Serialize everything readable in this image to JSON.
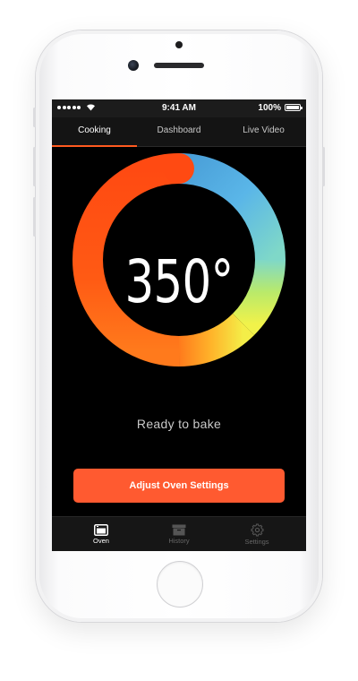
{
  "status_bar": {
    "time": "9:41 AM",
    "battery": "100%"
  },
  "tabs": [
    {
      "label": "Cooking",
      "active": true
    },
    {
      "label": "Dashboard",
      "active": false
    },
    {
      "label": "Live Video",
      "active": false
    }
  ],
  "oven": {
    "temperature": "350°",
    "status": "Ready to bake",
    "action_label": "Adjust Oven Settings",
    "gradient_colors": [
      "#ff4d12",
      "#ff8a1a",
      "#ffd43a",
      "#ecf04a",
      "#b9ea6a",
      "#7fd8c8",
      "#5ab6e8",
      "#4a9fd8"
    ]
  },
  "tab_bar": [
    {
      "label": "Oven",
      "icon": "oven-icon",
      "active": true
    },
    {
      "label": "History",
      "icon": "history-box-icon",
      "active": false
    },
    {
      "label": "Settings",
      "icon": "gear-icon",
      "active": false
    }
  ],
  "colors": {
    "accent": "#ff5a30",
    "background": "#000000"
  }
}
